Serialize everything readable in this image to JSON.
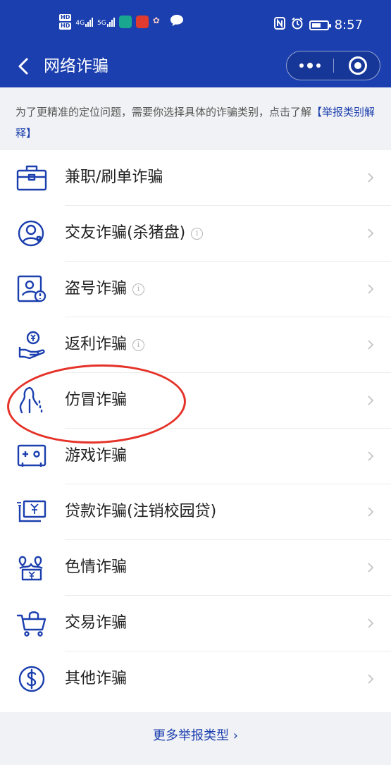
{
  "status_bar": {
    "hd_badges": [
      "HD",
      "HD"
    ],
    "network_1": "4G",
    "network_2": "5G",
    "time": "8:57"
  },
  "nav": {
    "title": "网络诈骗",
    "back_icon": "chevron-left-icon",
    "more_icon": "more-dots-icon",
    "close_icon": "target-close-icon"
  },
  "notice": {
    "text": "为了更精准的定位问题，需要你选择具体的诈骗类别，点击了解",
    "link": "【举报类别解释】"
  },
  "categories": [
    {
      "label": "兼职/刷单诈骗",
      "icon": "briefcase-icon",
      "info": false
    },
    {
      "label": "交友诈骗(杀猪盘)",
      "icon": "user-heart-icon",
      "info": true
    },
    {
      "label": "盗号诈骗",
      "icon": "account-theft-icon",
      "info": true
    },
    {
      "label": "返利诈骗",
      "icon": "money-hand-icon",
      "info": true
    },
    {
      "label": "仿冒诈骗",
      "icon": "impersonation-icon",
      "info": false
    },
    {
      "label": "游戏诈骗",
      "icon": "game-icon",
      "info": false
    },
    {
      "label": "贷款诈骗(注销校园贷)",
      "icon": "loan-icon",
      "info": false
    },
    {
      "label": "色情诈骗",
      "icon": "adult-content-icon",
      "info": false
    },
    {
      "label": "交易诈骗",
      "icon": "shopping-cart-icon",
      "info": false
    },
    {
      "label": "其他诈骗",
      "icon": "dollar-circle-icon",
      "info": false
    }
  ],
  "info_glyph": "i",
  "highlighted_item": "仿冒诈骗",
  "footer": {
    "more_types": "更多举报类型 ›"
  },
  "colors": {
    "brand": "#1b3fae",
    "annotation": "#e53228",
    "background": "#f1f2f5"
  }
}
